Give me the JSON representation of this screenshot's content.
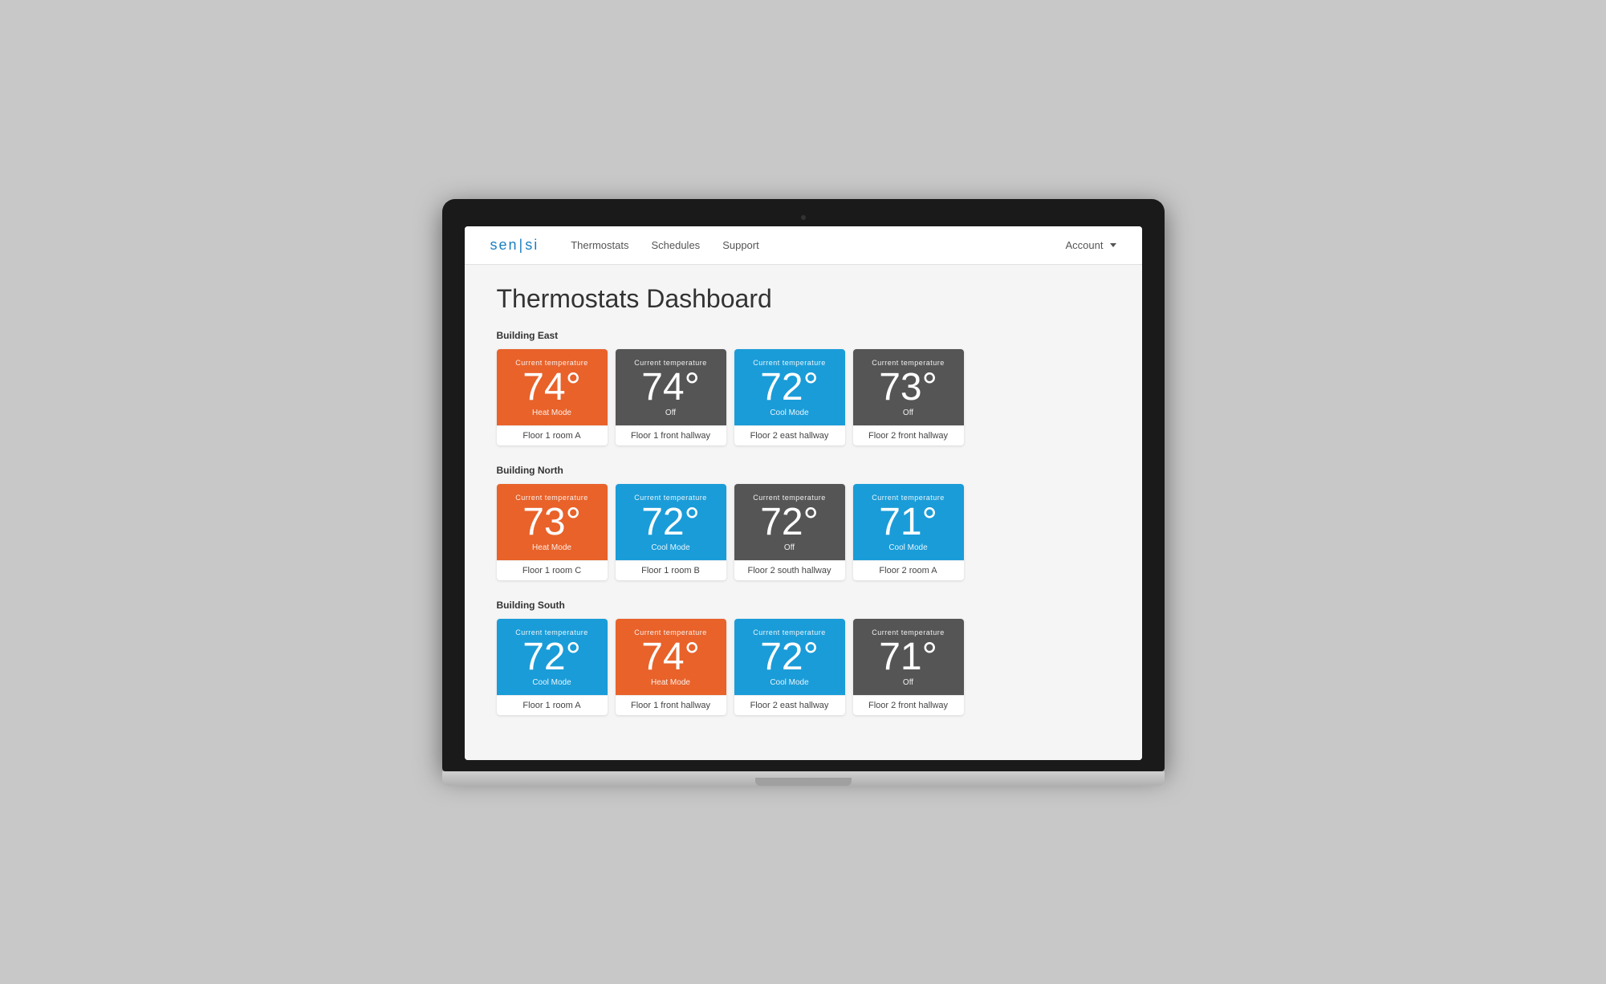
{
  "logo": {
    "text_left": "sen",
    "pipe": "|",
    "text_right": "si"
  },
  "nav": {
    "links": [
      {
        "label": "Thermostats"
      },
      {
        "label": "Schedules"
      },
      {
        "label": "Support"
      }
    ],
    "account_label": "Account"
  },
  "page": {
    "title": "Thermostats Dashboard"
  },
  "buildings": [
    {
      "name": "Building East",
      "thermostats": [
        {
          "temp": "74°",
          "mode": "Heat Mode",
          "mode_type": "heat",
          "location": "Floor 1 room A",
          "temp_label": "Current temperature"
        },
        {
          "temp": "74°",
          "mode": "Off",
          "mode_type": "off",
          "location": "Floor 1 front hallway",
          "temp_label": "Current temperature"
        },
        {
          "temp": "72°",
          "mode": "Cool Mode",
          "mode_type": "cool",
          "location": "Floor 2 east hallway",
          "temp_label": "Current temperature"
        },
        {
          "temp": "73°",
          "mode": "Off",
          "mode_type": "off",
          "location": "Floor 2 front hallway",
          "temp_label": "Current temperature"
        }
      ]
    },
    {
      "name": "Building North",
      "thermostats": [
        {
          "temp": "73°",
          "mode": "Heat Mode",
          "mode_type": "heat",
          "location": "Floor 1 room C",
          "temp_label": "Current temperature"
        },
        {
          "temp": "72°",
          "mode": "Cool Mode",
          "mode_type": "cool",
          "location": "Floor 1 room B",
          "temp_label": "Current temperature"
        },
        {
          "temp": "72°",
          "mode": "Off",
          "mode_type": "off",
          "location": "Floor 2 south hallway",
          "temp_label": "Current temperature"
        },
        {
          "temp": "71°",
          "mode": "Cool Mode",
          "mode_type": "cool",
          "location": "Floor 2 room A",
          "temp_label": "Current temperature"
        }
      ]
    },
    {
      "name": "Building South",
      "thermostats": [
        {
          "temp": "72°",
          "mode": "Cool Mode",
          "mode_type": "cool",
          "location": "Floor 1 room A",
          "temp_label": "Current temperature"
        },
        {
          "temp": "74°",
          "mode": "Heat Mode",
          "mode_type": "heat",
          "location": "Floor 1 front hallway",
          "temp_label": "Current temperature"
        },
        {
          "temp": "72°",
          "mode": "Cool Mode",
          "mode_type": "cool",
          "location": "Floor 2 east hallway",
          "temp_label": "Current temperature"
        },
        {
          "temp": "71°",
          "mode": "Off",
          "mode_type": "off",
          "location": "Floor 2 front hallway",
          "temp_label": "Current temperature"
        }
      ]
    }
  ]
}
